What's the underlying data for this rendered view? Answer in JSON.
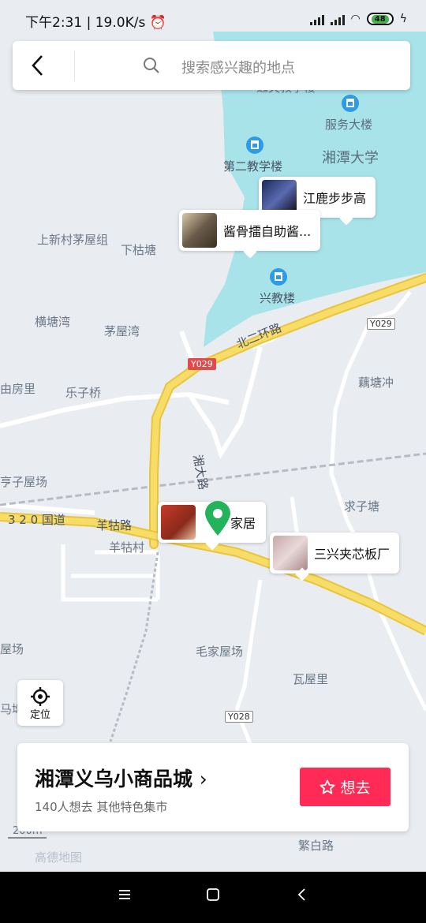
{
  "status_bar": {
    "time": "下午2:31",
    "net_speed": "19.0K/s",
    "battery": "48"
  },
  "search": {
    "placeholder": "搜索感兴趣的地点"
  },
  "poi_cards": [
    {
      "name": "江鹿步步高"
    },
    {
      "name": "酱骨擂自助酱..."
    },
    {
      "name": "家居"
    },
    {
      "name": "三兴夹芯板厂"
    }
  ],
  "labels": {
    "jiaoxuelou": "逸夫教学楼",
    "fuwudalou": "服务大楼",
    "xiangtan_univ": "湘潭大学",
    "dierjiaoxue": "第二教学楼",
    "shangxincun": "上新村茅屋组",
    "xiagutang": "下枯塘",
    "xingjiaolou": "兴教楼",
    "hengtangwan": "横塘湾",
    "maowuwan": "茅屋湾",
    "beierhuanlu": "北二环路",
    "youfangli": "由房里",
    "lezijiao": "乐子桥",
    "outangchong": "藕塘冲",
    "xiangdalu": "湘大路",
    "zizihuchang": "亨子屋场",
    "qiuzitang": "求子塘",
    "guodao": "3 2 0 国道",
    "yanggulu": "羊牯路",
    "yanggucun": "羊牯村",
    "maojiawuchang": "毛家屋场",
    "wawuli": "瓦屋里",
    "wuchang": "屋场",
    "matou": "马坳",
    "fanbailu": "繁白路",
    "scale": "200m",
    "gaode": "高德地图"
  },
  "road_shields": {
    "y029a": "Y029",
    "y029b": "Y029",
    "y028": "Y028"
  },
  "locate_button": {
    "label": "定位"
  },
  "place_card": {
    "title": "湘潭义乌小商品城",
    "subtitle": "140人想去   其他特色集市",
    "want_button": "想去"
  },
  "colors": {
    "accent": "#ff2a55",
    "pin": "#23b35a",
    "water": "#a8e3ea",
    "road": "#f5d860"
  }
}
